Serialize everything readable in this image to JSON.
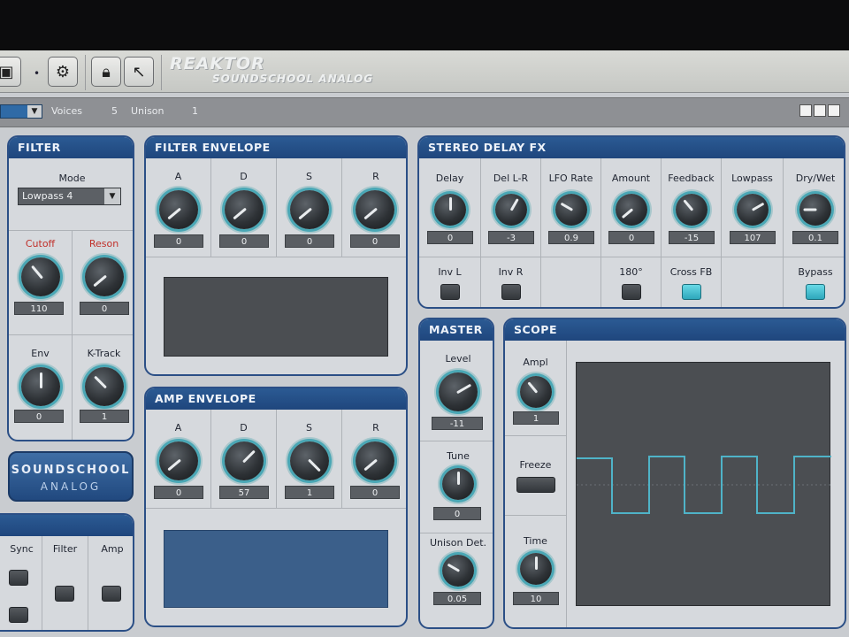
{
  "app": {
    "brand": "REAKTOR",
    "subtitle": "SOUNDSCHOOL ANALOG"
  },
  "toolbar": {
    "icons": [
      "panel-icon",
      "bullet-icon",
      "snapshot-icon",
      "lock-icon",
      "cursor-icon"
    ]
  },
  "instrument_bar": {
    "voices_label": "Voices",
    "voices_value": "5",
    "unison_label": "Unison",
    "unison_value": "1"
  },
  "filter": {
    "title": "FILTER",
    "mode_label": "Mode",
    "mode_value": "Lowpass 4",
    "cutoff_label": "Cutoff",
    "cutoff_value": "110",
    "reson_label": "Reson",
    "reson_value": "0",
    "env_label": "Env",
    "env_value": "0",
    "ktrack_label": "K-Track",
    "ktrack_value": "1"
  },
  "filter_env": {
    "title": "FILTER ENVELOPE",
    "labels": [
      "A",
      "D",
      "S",
      "R"
    ],
    "values": [
      "0",
      "0",
      "0",
      "0"
    ]
  },
  "amp_env": {
    "title": "AMP ENVELOPE",
    "labels": [
      "A",
      "D",
      "S",
      "R"
    ],
    "values": [
      "0",
      "57",
      "1",
      "0"
    ]
  },
  "delay": {
    "title": "STEREO DELAY FX",
    "labels": [
      "Delay",
      "Del L-R",
      "LFO Rate",
      "Amount",
      "Feedback",
      "Lowpass",
      "Dry/Wet"
    ],
    "values": [
      "0",
      "-3",
      "0.9",
      "0",
      "-15",
      "107",
      "0.1"
    ],
    "inv_l": "Inv L",
    "inv_r": "Inv R",
    "deg180": "180°",
    "cross_fb": "Cross FB",
    "bypass": "Bypass"
  },
  "master": {
    "title": "MASTER",
    "level_label": "Level",
    "level_value": "-11",
    "tune_label": "Tune",
    "tune_value": "0",
    "unison_det_label": "Unison Det.",
    "unison_det_value": "0.05"
  },
  "scope": {
    "title": "SCOPE",
    "ampl_label": "Ampl",
    "ampl_value": "1",
    "freeze_label": "Freeze",
    "time_label": "Time",
    "time_value": "10"
  },
  "logo": {
    "line1": "SOUNDSCHOOL",
    "line2": "ANALOG"
  },
  "lfo_partial": {
    "labels": [
      "Sync",
      "Filter",
      "Amp"
    ]
  },
  "colors": {
    "panel_header": "#2b5a93",
    "knob_ring": "#4aa7b5",
    "button_on": "#3fbfd0",
    "scope_trace": "#4fb3c8"
  }
}
